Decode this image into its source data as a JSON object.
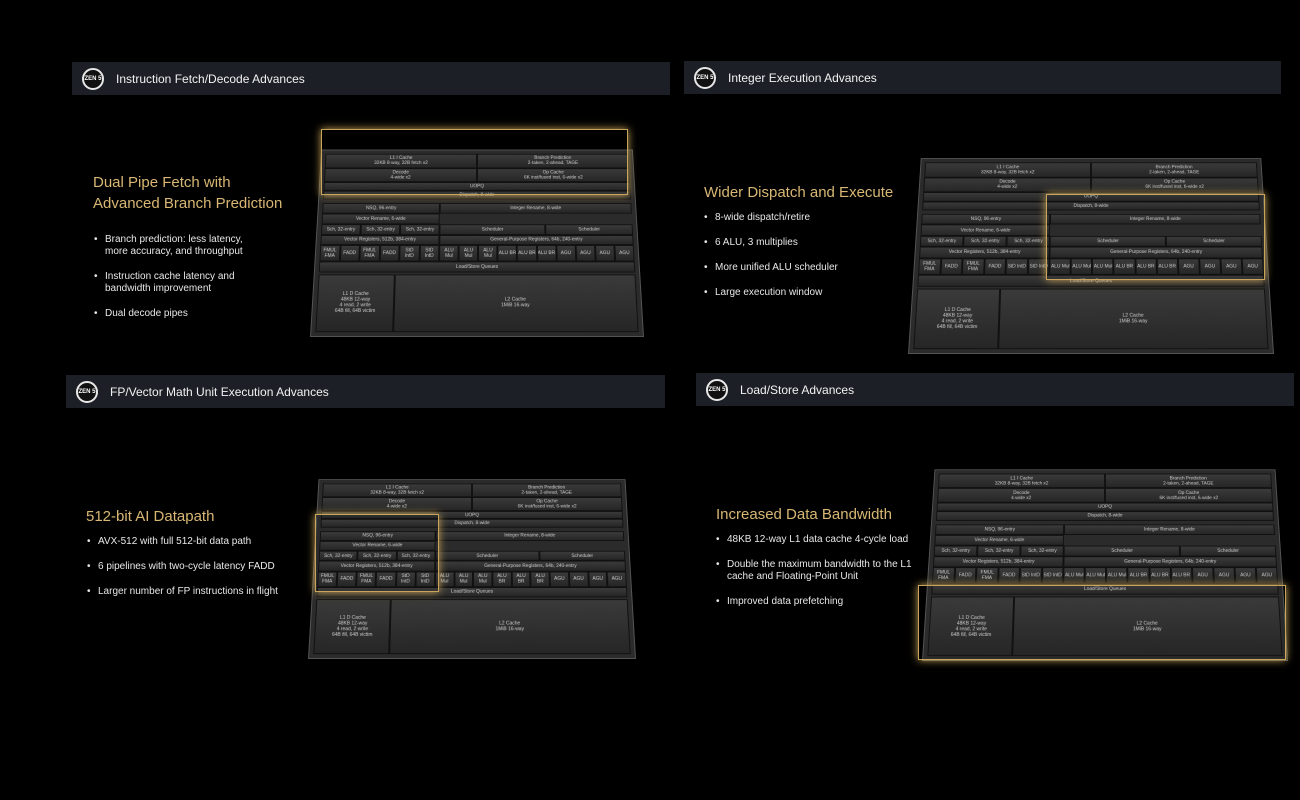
{
  "panels": [
    {
      "title": "Instruction Fetch/Decode Advances",
      "headline_1": "Dual Pipe Fetch with",
      "headline_2": "Advanced Branch Prediction",
      "bullets": [
        "Branch prediction: less latency, more accuracy, and throughput",
        "Instruction cache latency and bandwidth improvement",
        "Dual decode pipes"
      ]
    },
    {
      "title": "Integer Execution Advances",
      "headline_1": "Wider Dispatch and Execute",
      "headline_2": "",
      "bullets": [
        "8-wide dispatch/retire",
        "6 ALU, 3 multiplies",
        "More unified ALU scheduler",
        "Large execution window"
      ]
    },
    {
      "title": "FP/Vector Math Unit Execution Advances",
      "headline_1": "512-bit AI Datapath",
      "headline_2": "",
      "bullets": [
        "AVX-512 with full 512-bit data path",
        "6 pipelines with two-cycle latency FADD",
        "Larger number of FP instructions in flight"
      ]
    },
    {
      "title": "Load/Store Advances",
      "headline_1": "Increased Data Bandwidth",
      "headline_2": "",
      "bullets": [
        "48KB 12-way L1 data cache 4-cycle load",
        "Double the maximum bandwidth to the L1 cache and Floating-Point Unit",
        "Improved data prefetching"
      ]
    }
  ],
  "logo_text": "ZEN 5",
  "diagram": {
    "l1i": "L1 I Cache\n32KB 8-way, 32B fetch x2",
    "bp": "Branch Prediction\n2-taken, 2-ahead, TAGE",
    "decode": "Decode\n4-wide x2",
    "opcache": "Op Cache\n6K inst/fused inst, 6-wide x2",
    "uopq": "UOPQ",
    "dispatch": "Dispatch, 8-wide",
    "nsq": "NSQ, 96-entry",
    "vrename": "Vector Rename, 6-wide",
    "irename": "Integer Rename, 8-wide",
    "sch1": "Sch, 32-entry",
    "sch2": "Sch, 32-entry",
    "sch3": "Sch, 32-entry",
    "isched1": "Scheduler",
    "isched2": "Scheduler",
    "vregs": "Vector Registers, 512b, 384-entry",
    "gprs": "General-Purpose Registers, 64b, 240-entry",
    "fpu": [
      "FMUL FMA",
      "FADD",
      "FMUL FMA",
      "FADD",
      "StD IntD",
      "StD IntD"
    ],
    "alu": [
      "ALU Mul",
      "ALU Mul",
      "ALU Mul",
      "ALU BR",
      "ALU BR",
      "ALU BR",
      "AGU",
      "AGU",
      "AGU",
      "AGU"
    ],
    "lsq": "Load/Store Queues",
    "l1d": "L1 D Cache\n48KB 12-way\n4 read, 2 write\n64B fill, 64B victim",
    "l2": "L2 Cache\n1MiB 16-way"
  }
}
